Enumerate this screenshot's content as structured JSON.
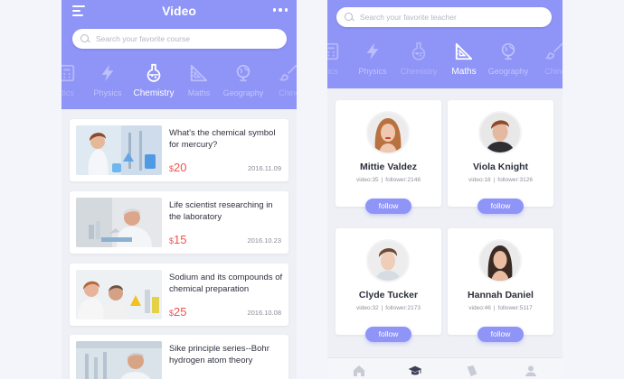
{
  "left_screen": {
    "title": "Video",
    "search_placeholder": "Search your favorite course",
    "tabs": [
      {
        "label": "itics",
        "icon": "calculator-icon"
      },
      {
        "label": "Physics",
        "icon": "lightning-icon"
      },
      {
        "label": "Chemistry",
        "icon": "flask-icon",
        "active": true
      },
      {
        "label": "Maths",
        "icon": "set-square-icon"
      },
      {
        "label": "Geography",
        "icon": "globe-icon"
      },
      {
        "label": "Chine",
        "icon": "brush-icon"
      }
    ],
    "courses": [
      {
        "title": "What's the chemical symbol for mercury?",
        "currency": "$",
        "price": "20",
        "date": "2016.11.09"
      },
      {
        "title": "Life scientist researching in the laboratory",
        "currency": "$",
        "price": "15",
        "date": "2016.10.23"
      },
      {
        "title": "Sodium and its compounds of chemical preparation",
        "currency": "$",
        "price": "25",
        "date": "2016.10.08"
      },
      {
        "title": "Sike principle series--Bohr hydrogen atom theory",
        "currency": "",
        "price": "",
        "date": ""
      }
    ]
  },
  "right_screen": {
    "search_placeholder": "Search your favorite teacher",
    "tabs": [
      {
        "label": "itics",
        "icon": "calculator-icon"
      },
      {
        "label": "Physics",
        "icon": "lightning-icon"
      },
      {
        "label": "Chemistry",
        "icon": "flask-icon"
      },
      {
        "label": "Maths",
        "icon": "set-square-icon",
        "active": true
      },
      {
        "label": "Geography",
        "icon": "globe-icon"
      },
      {
        "label": "Chine",
        "icon": "brush-icon"
      }
    ],
    "teachers": [
      {
        "name": "Mittie Valdez",
        "video": "video:35",
        "follower": "follower:2148",
        "follow_label": "follow"
      },
      {
        "name": "Viola Knight",
        "video": "video:18",
        "follower": "follower:3126",
        "follow_label": "follow"
      },
      {
        "name": "Clyde Tucker",
        "video": "video:32",
        "follower": "follower:2173",
        "follow_label": "follow"
      },
      {
        "name": "Hannah Daniel",
        "video": "video:46",
        "follower": "follower:5117",
        "follow_label": "follow"
      }
    ],
    "stat_separator": "|",
    "bottom_nav": [
      {
        "icon": "home-icon"
      },
      {
        "icon": "graduation-cap-icon",
        "active": true
      },
      {
        "icon": "book-icon"
      },
      {
        "icon": "user-icon"
      }
    ]
  },
  "colors": {
    "accent": "#8f94f7",
    "price": "#f0524d",
    "card_bg": "#ffffff",
    "page_bg": "#eef0f5"
  }
}
